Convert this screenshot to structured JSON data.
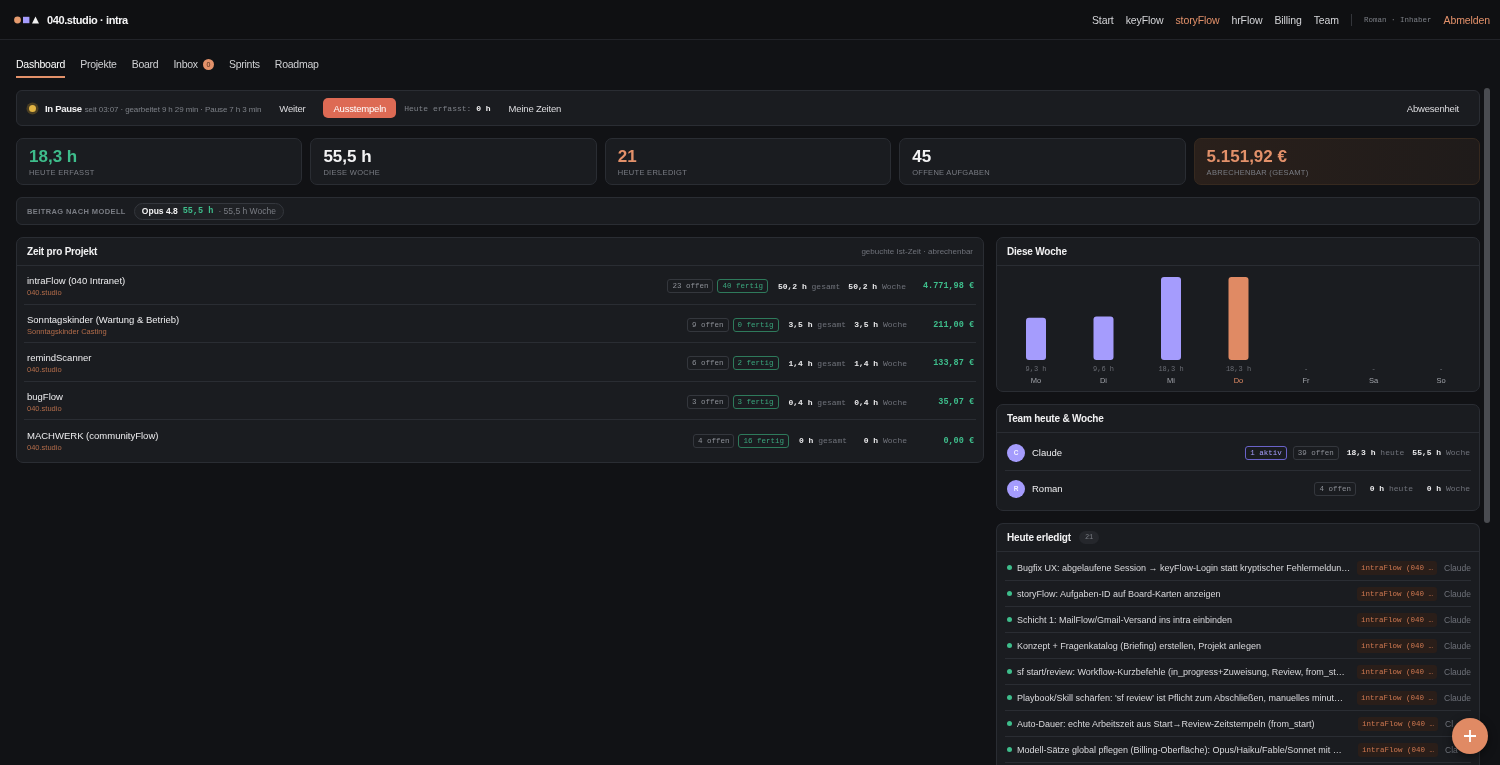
{
  "header": {
    "brand": "040.studio · intra",
    "nav": [
      {
        "label": "Start",
        "selected": false
      },
      {
        "label": "keyFlow",
        "selected": false
      },
      {
        "label": "storyFlow",
        "selected": true
      },
      {
        "label": "hrFlow",
        "selected": false
      },
      {
        "label": "Billing",
        "selected": false
      },
      {
        "label": "Team",
        "selected": false
      }
    ],
    "user": "Roman · Inhaber",
    "logout": "Abmelden"
  },
  "tabs": [
    {
      "label": "Dashboard",
      "selected": true
    },
    {
      "label": "Projekte",
      "selected": false
    },
    {
      "label": "Board",
      "selected": false
    },
    {
      "label": "Inbox",
      "selected": false,
      "badge": "0"
    },
    {
      "label": "Sprints",
      "selected": false
    },
    {
      "label": "Roadmap",
      "selected": false
    }
  ],
  "clock": {
    "paused": true,
    "status": "In Pause",
    "meta": "seit 03:07 · gearbeitet 9 h 29 min · Pause 7 h 3 min",
    "items": [
      {
        "kind": "button",
        "label": "Weiter"
      },
      {
        "kind": "primary",
        "label": "Ausstempeln"
      },
      {
        "kind": "reading",
        "label": "Heute erfasst:",
        "value": "0 h"
      },
      {
        "kind": "button",
        "label": "Meine Zeiten"
      }
    ],
    "side_button": "Abwesenheit"
  },
  "stats": [
    {
      "value": "18,3 h",
      "label": "HEUTE ERFASST",
      "color": "#3ebd8b",
      "highlight": false
    },
    {
      "value": "55,5 h",
      "label": "DIESE WOCHE",
      "color": "#f3f3f4",
      "highlight": false
    },
    {
      "value": "21",
      "label": "HEUTE ERLEDIGT",
      "color": "#e3916a",
      "highlight": false
    },
    {
      "value": "45",
      "label": "OFFENE AUFGABEN",
      "color": "#f3f3f4",
      "highlight": false
    },
    {
      "value": "5.151,92 €",
      "label": "ABRECHENBAR (GESAMT)",
      "color": "#e3916a",
      "highlight": true
    }
  ],
  "model_breakdown": {
    "label": "BEITRAG NACH MODELL",
    "models": [
      {
        "name": "Opus 4.8",
        "hours": "55,5 h",
        "week": "· 55,5 h Woche"
      }
    ]
  },
  "projects": {
    "title": "Zeit pro Projekt",
    "note": "gebuchte Ist-Zeit · abrechenbar",
    "rows": [
      {
        "name": "intraFlow (040 Intranet)",
        "client": "040.studio",
        "open": "23 offen",
        "done": "40 fertig",
        "total": "50,2 h",
        "total_label": "gesamt",
        "week": "50,2 h",
        "week_label": "Woche",
        "amount": "4.771,98 €"
      },
      {
        "name": "Sonntagskinder (Wartung & Betrieb)",
        "client": "Sonntagskinder Casting",
        "open": "9 offen",
        "done": "0 fertig",
        "total": "3,5 h",
        "total_label": "gesamt",
        "week": "3,5 h",
        "week_label": "Woche",
        "amount": "211,00 €"
      },
      {
        "name": "remindScanner",
        "client": "040.studio",
        "open": "6 offen",
        "done": "2 fertig",
        "total": "1,4 h",
        "total_label": "gesamt",
        "week": "1,4 h",
        "week_label": "Woche",
        "amount": "133,87 €"
      },
      {
        "name": "bugFlow",
        "client": "040.studio",
        "open": "3 offen",
        "done": "3 fertig",
        "total": "0,4 h",
        "total_label": "gesamt",
        "week": "0,4 h",
        "week_label": "Woche",
        "amount": "35,07 €"
      },
      {
        "name": "MACHWERK (communityFlow)",
        "client": "040.studio",
        "open": "4 offen",
        "done": "16 fertig",
        "total": "0 h",
        "total_label": "gesamt",
        "week": "0 h",
        "week_label": "Woche",
        "amount": "0,00 €"
      }
    ]
  },
  "week": {
    "title": "Diese Woche",
    "chart_data": {
      "type": "bar",
      "categories": [
        "Mo",
        "Di",
        "Mi",
        "Do",
        "Fr",
        "Sa",
        "So"
      ],
      "values": [
        9.3,
        9.6,
        18.3,
        18.3,
        null,
        null,
        null
      ],
      "value_labels": [
        "9,3 h",
        "9,6 h",
        "18,3 h",
        "18,3 h",
        "-",
        "-",
        "-"
      ]
    },
    "days": [
      {
        "today": false
      },
      {
        "today": false
      },
      {
        "today": false
      },
      {
        "today": true
      },
      {
        "today": false
      },
      {
        "today": false
      },
      {
        "today": false
      }
    ]
  },
  "team": {
    "title": "Team heute & Woche",
    "members": [
      {
        "initial": "C",
        "name": "Claude",
        "active": "1 aktiv",
        "open": "39 offen",
        "today": "18,3 h",
        "today_label": "heute",
        "week": "55,5 h",
        "week_label": "Woche"
      },
      {
        "initial": "R",
        "name": "Roman",
        "open": "4 offen",
        "today": "0 h",
        "today_label": "heute",
        "week": "0 h",
        "week_label": "Woche"
      }
    ]
  },
  "done_today": {
    "title": "Heute erledigt",
    "count": "21",
    "items": [
      {
        "text": "Bugfix UX: abgelaufene Session → keyFlow-Login statt kryptischer Fehlermeldun…",
        "project": "intraFlow (040 …",
        "assignee": "Claude"
      },
      {
        "text": "storyFlow: Aufgaben-ID auf Board-Karten anzeigen",
        "project": "intraFlow (040 …",
        "assignee": "Claude"
      },
      {
        "text": "Schicht 1: MailFlow/Gmail-Versand ins intra einbinden",
        "project": "intraFlow (040 …",
        "assignee": "Claude"
      },
      {
        "text": "Konzept + Fragenkatalog (Briefing) erstellen, Projekt anlegen",
        "project": "intraFlow (040 …",
        "assignee": "Claude"
      },
      {
        "text": "sf start/review: Workflow-Kurzbefehle (in_progress+Zuweisung, Review, from_st…",
        "project": "intraFlow (040 …",
        "assignee": "Claude"
      },
      {
        "text": "Playbook/Skill schärfen: 'sf review' ist Pflicht zum Abschließen, manuelles minut…",
        "project": "intraFlow (040 …",
        "assignee": "Claude"
      },
      {
        "text": "Auto-Dauer: echte Arbeitszeit aus Start→Review-Zeitstempeln (from_start)",
        "project": "intraFlow (040 …",
        "assignee": "Cl"
      },
      {
        "text": "Modell-Sätze global pflegen (Billing-Oberfläche): Opus/Haiku/Fable/Sonnet mit …",
        "project": "intraFlow (040 …",
        "assignee": "Cla"
      }
    ]
  }
}
